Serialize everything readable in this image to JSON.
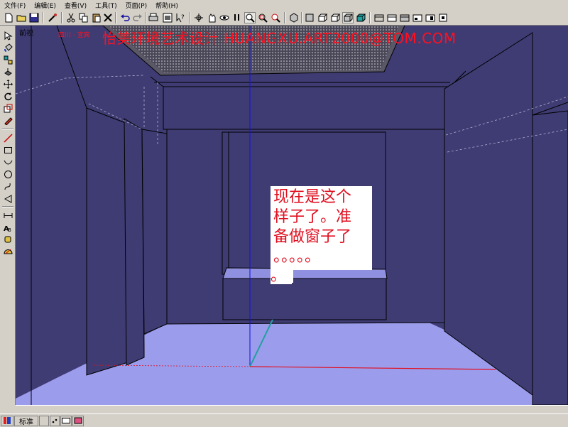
{
  "menu": {
    "items": [
      "文件(F)",
      "编辑(E)",
      "查看(V)",
      "工具(T)",
      "页面(P)",
      "帮助(H)"
    ]
  },
  "toolbar": {
    "icons": [
      "new-file-icon",
      "open-folder-icon",
      "save-icon",
      "make-component-icon",
      "cut-icon",
      "copy-icon",
      "paste-icon",
      "erase-icon",
      "undo-icon",
      "redo-icon",
      "print-icon",
      "model-info-icon",
      "help-icon",
      "orbit-icon",
      "pan-icon",
      "walk-icon",
      "look-around-icon",
      "zoom-icon",
      "zoom-window-icon",
      "zoom-extents-icon",
      "iso-view-icon",
      "top-view-icon",
      "front-view-icon",
      "right-view-icon",
      "back-view-icon",
      "left-view-icon",
      "wireframe-icon",
      "hidden-line-icon",
      "shaded-icon",
      "shaded-texture-icon",
      "xray-icon"
    ]
  },
  "left_tools": {
    "icons": [
      "select-icon",
      "paint-bucket-icon",
      "component-icon",
      "push-pull-icon",
      "move-icon",
      "rotate-icon",
      "scale-icon",
      "eraser-icon",
      "line-icon",
      "rectangle-icon",
      "arc-icon",
      "circle-icon",
      "freehand-icon",
      "polygon-icon",
      "dimension-icon",
      "text-icon",
      "tape-measure-icon",
      "protractor-icon"
    ]
  },
  "viewport": {
    "view_label": "前视",
    "small_text": "四川 · 宜宾",
    "watermark": "怡美环境艺术设计  HUANGXU.ART2000@TOM.COM",
    "note_lines": [
      "现在是这个",
      "样子了。准",
      "备做窗子了",
      "。。。。。",
      "。"
    ]
  },
  "taskbar": {
    "ime_mode": "标准"
  },
  "colors": {
    "wall": "#3f3c74",
    "floor": "#9c9cec",
    "ceiling_panel": "#d4d0c8",
    "edge": "#000000",
    "axis_blue": "#1010e0",
    "axis_red": "#e01020",
    "axis_green": "#20a0a0",
    "accent_red": "#ff1020"
  }
}
